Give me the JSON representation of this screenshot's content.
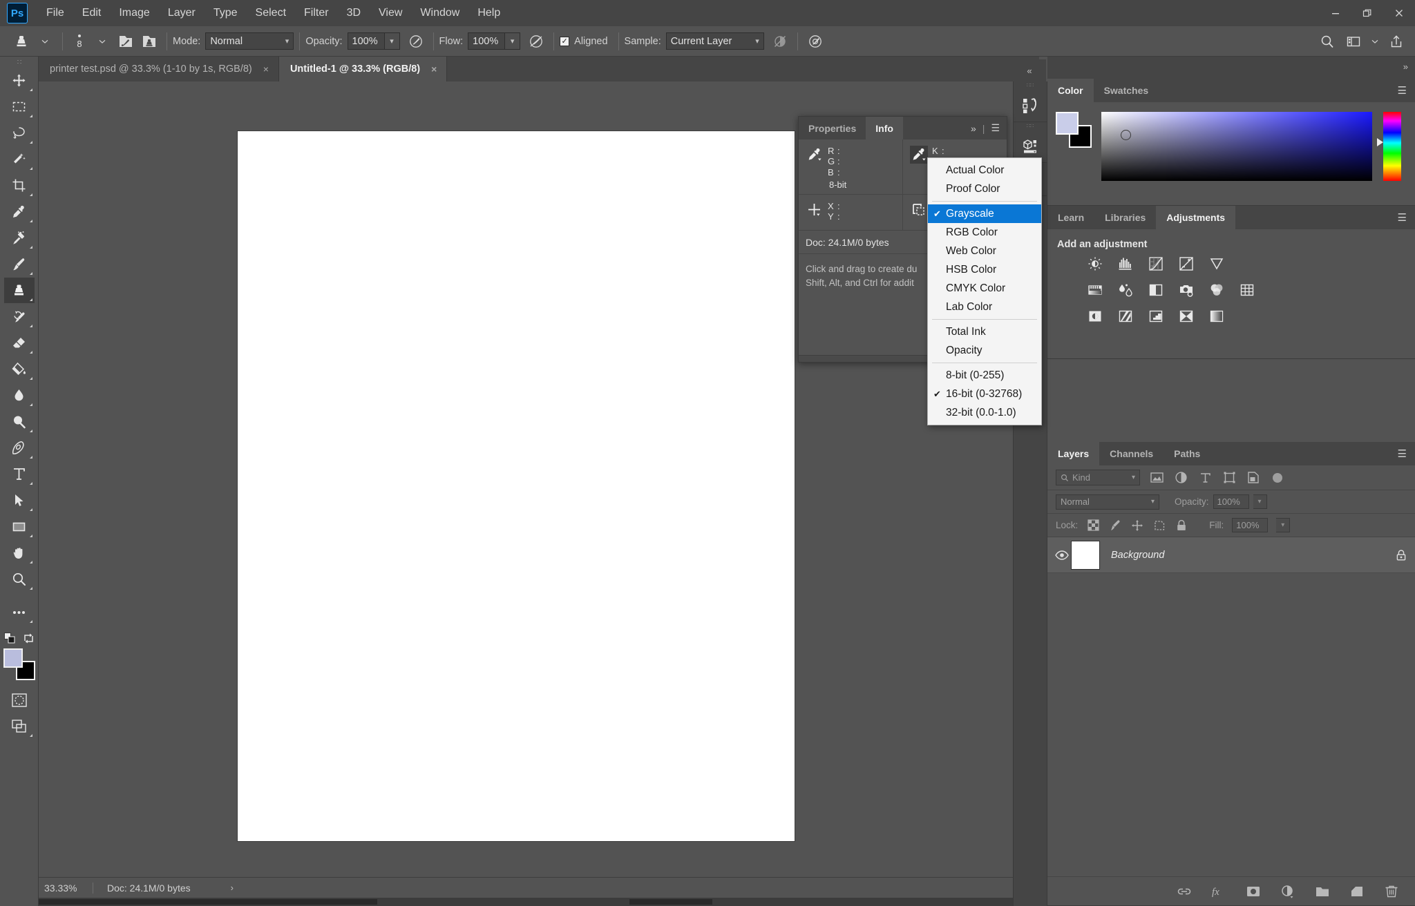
{
  "app": {
    "logo": "Ps",
    "menus": [
      "File",
      "Edit",
      "Image",
      "Layer",
      "Type",
      "Select",
      "Filter",
      "3D",
      "View",
      "Window",
      "Help"
    ],
    "window_controls": {
      "minimize": "minimize-icon",
      "restore": "restore-icon",
      "close": "close-icon"
    }
  },
  "options_bar": {
    "tool_icon": "clone-stamp-icon",
    "tool_preset_caret": "chevron-down-icon",
    "brush_size": "8",
    "brush_caret": "chevron-down-icon",
    "brush_panel_icon": "brush-settings-icon",
    "clone_source_icon": "clone-source-icon",
    "mode_label": "Mode:",
    "mode_value": "Normal",
    "opacity_label": "Opacity:",
    "opacity_value": "100%",
    "opacity_pressure_icon": "pressure-opacity-icon",
    "flow_label": "Flow:",
    "flow_value": "100%",
    "flow_pressure_icon": "pressure-flow-icon",
    "aligned_label": "Aligned",
    "aligned_checked": true,
    "sample_label": "Sample:",
    "sample_value": "Current Layer",
    "ignore_adjustment_icon": "ignore-adjustment-layers-icon",
    "airbrush_icon": "airbrush-icon",
    "right_icons": [
      "search-icon",
      "workspace-icon",
      "chevron-down-icon",
      "share-icon"
    ]
  },
  "document_tabs": [
    {
      "label": "printer test.psd @ 33.3% (1-10 by 1s, RGB/8)",
      "active": false,
      "close": "×"
    },
    {
      "label": "Untitled-1 @ 33.3% (RGB/8)",
      "active": true,
      "close": "×"
    }
  ],
  "tools": [
    {
      "name": "move-tool",
      "icon": "move-icon",
      "active": false
    },
    {
      "name": "rectangular-marquee-tool",
      "icon": "marquee-icon",
      "active": false
    },
    {
      "name": "lasso-tool",
      "icon": "lasso-icon",
      "active": false
    },
    {
      "name": "object-selection-tool",
      "icon": "magic-wand-icon",
      "active": false
    },
    {
      "name": "crop-tool",
      "icon": "crop-icon",
      "active": false
    },
    {
      "name": "eyedropper-tool",
      "icon": "eyedropper-icon",
      "active": false
    },
    {
      "name": "spot-healing-brush-tool",
      "icon": "healing-brush-icon",
      "active": false
    },
    {
      "name": "brush-tool",
      "icon": "brush-icon",
      "active": false
    },
    {
      "name": "clone-stamp-tool",
      "icon": "clone-stamp-icon",
      "active": true
    },
    {
      "name": "history-brush-tool",
      "icon": "history-brush-icon",
      "active": false
    },
    {
      "name": "eraser-tool",
      "icon": "eraser-icon",
      "active": false
    },
    {
      "name": "gradient-tool",
      "icon": "paint-bucket-icon",
      "active": false
    },
    {
      "name": "blur-tool",
      "icon": "blur-drop-icon",
      "active": false
    },
    {
      "name": "dodge-tool",
      "icon": "dodge-icon",
      "active": false
    },
    {
      "name": "pen-tool",
      "icon": "pen-icon",
      "active": false
    },
    {
      "name": "type-tool",
      "icon": "type-t-icon",
      "active": false
    },
    {
      "name": "path-selection-tool",
      "icon": "path-arrow-icon",
      "active": false
    },
    {
      "name": "rectangle-tool",
      "icon": "rectangle-icon",
      "active": false
    },
    {
      "name": "hand-tool",
      "icon": "hand-icon",
      "active": false
    },
    {
      "name": "zoom-tool",
      "icon": "magnifier-icon",
      "active": false
    },
    {
      "name": "edit-toolbar",
      "icon": "ellipsis-icon",
      "active": false
    }
  ],
  "tool_footer": {
    "default_colors_icon": "default-colors-icon",
    "swap_colors_icon": "swap-colors-icon",
    "foreground_color": "#b9bddd",
    "background_color": "#000000",
    "quick_mask_icon": "quick-mask-icon",
    "screen_mode_icon": "screen-mode-icon"
  },
  "info_panel": {
    "tabs": [
      {
        "label": "Properties",
        "active": false
      },
      {
        "label": "Info",
        "active": true
      }
    ],
    "overflow_icon": "chevron-double-right-icon",
    "menu_icon": "panel-menu-icon",
    "rgb_channels": [
      "R",
      "G",
      "B"
    ],
    "channel_sep": ":",
    "bit_depth": "8-bit",
    "k_channel": "K",
    "coord_labels": [
      "X",
      "Y"
    ],
    "doc_size": "Doc: 24.1M/0 bytes",
    "hint_line1": "Click and drag to create du",
    "hint_line2": "Shift, Alt, and Ctrl for addit",
    "first_eyedropper_icon": "eyedropper-icon",
    "second_eyedropper_icon": "eyedropper-icon",
    "crosshair_icon": "crosshair-icon",
    "selection_size_icon": "selection-size-icon"
  },
  "context_menu": {
    "items": [
      {
        "label": "Actual Color",
        "checked": false,
        "selected": false
      },
      {
        "label": "Proof Color",
        "checked": false,
        "selected": false
      },
      {
        "separator": true
      },
      {
        "label": "Grayscale",
        "checked": true,
        "selected": true
      },
      {
        "label": "RGB Color",
        "checked": false,
        "selected": false
      },
      {
        "label": "Web Color",
        "checked": false,
        "selected": false
      },
      {
        "label": "HSB Color",
        "checked": false,
        "selected": false
      },
      {
        "label": "CMYK Color",
        "checked": false,
        "selected": false
      },
      {
        "label": "Lab Color",
        "checked": false,
        "selected": false
      },
      {
        "separator": true
      },
      {
        "label": "Total Ink",
        "checked": false,
        "selected": false
      },
      {
        "label": "Opacity",
        "checked": false,
        "selected": false
      },
      {
        "separator": true
      },
      {
        "label": "8-bit (0-255)",
        "checked": false,
        "selected": false
      },
      {
        "label": "16-bit (0-32768)",
        "checked": true,
        "selected": false
      },
      {
        "label": "32-bit (0.0-1.0)",
        "checked": false,
        "selected": false
      }
    ],
    "highlight_color": "#0a77d5"
  },
  "icon_rail": {
    "collapse_icon": "chevron-double-left-icon",
    "buttons": [
      {
        "name": "history-panel-button",
        "icon": "history-icon"
      },
      {
        "name": "3d-panel-button",
        "icon": "cube-icon"
      },
      {
        "name": "info-panel-button",
        "icon": "info-circle-icon"
      }
    ]
  },
  "color_panel": {
    "tabs": [
      {
        "label": "Color",
        "active": true
      },
      {
        "label": "Swatches",
        "active": false
      }
    ],
    "menu_icon": "panel-menu-icon",
    "foreground_color": "#c9cde9",
    "background_color": "#000000",
    "field_icon": "color-field",
    "hue_slider_icon": "hue-slider"
  },
  "adjustments_panel": {
    "tabs": [
      {
        "label": "Learn",
        "active": false
      },
      {
        "label": "Libraries",
        "active": false
      },
      {
        "label": "Adjustments",
        "active": true
      }
    ],
    "menu_icon": "panel-menu-icon",
    "title": "Add an adjustment",
    "rows": [
      [
        "brightness-contrast-icon",
        "levels-icon",
        "curves-icon",
        "exposure-icon",
        "vibrance-icon"
      ],
      [
        "hue-saturation-icon",
        "color-balance-icon",
        "black-white-icon",
        "photo-filter-icon",
        "channel-mixer-icon",
        "color-lookup-icon"
      ],
      [
        "invert-icon",
        "posterize-icon",
        "threshold-icon",
        "gradient-map-icon",
        "selective-color-icon"
      ]
    ]
  },
  "layers_panel": {
    "tabs": [
      {
        "label": "Layers",
        "active": true
      },
      {
        "label": "Channels",
        "active": false
      },
      {
        "label": "Paths",
        "active": false
      }
    ],
    "menu_icon": "panel-menu-icon",
    "filter_label": "Kind",
    "filter_icon": "search-icon",
    "filter_type_icons": [
      "pixel-layer-icon",
      "adjustment-layer-icon",
      "type-layer-icon",
      "shape-layer-icon",
      "smart-object-icon"
    ],
    "filter_toggle": "filter-toggle",
    "blend_mode": "Normal",
    "opacity_label": "Opacity:",
    "opacity_value": "100%",
    "lock_label": "Lock:",
    "lock_icons": [
      "lock-transparency-icon",
      "lock-image-icon",
      "lock-position-icon",
      "lock-artboard-icon",
      "lock-all-icon"
    ],
    "fill_label": "Fill:",
    "fill_value": "100%",
    "layers": [
      {
        "name": "Background",
        "visible": true,
        "locked": true,
        "visibility_icon": "eye-icon",
        "lock_icon": "lock-icon"
      }
    ],
    "footer_icons": [
      "link-layers-icon",
      "fx-icon",
      "add-mask-icon",
      "new-adjustment-layer-icon",
      "new-group-icon",
      "new-layer-icon",
      "delete-layer-icon"
    ]
  },
  "status_bar": {
    "zoom": "33.33%",
    "doc_info": "Doc: 24.1M/0 bytes",
    "expand_icon": "chevron-right-icon"
  },
  "colors": {
    "menubar_bg": "#454545",
    "panel_bg": "#535353",
    "canvas_bg": "#535353",
    "accent_blue": "#31a8ff",
    "menu_highlight": "#0a77d5",
    "artboard": "#ffffff"
  }
}
